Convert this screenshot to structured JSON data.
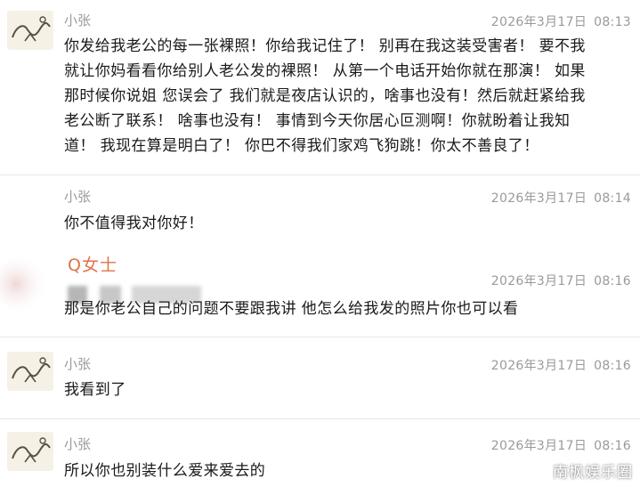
{
  "messages": [
    {
      "sender": "小张",
      "date": "2026年3月17日",
      "time": "08:13",
      "lines": [
        "你发给我老公的每一张裸照！你给我记住了！ 别再在我这装受害者！ 要不我",
        "就让你妈看看你给别人老公发的裸照！ 从第一个电话开始你就在那演！ 如果",
        "那时候你说姐 您误会了 我们就是夜店认识的，啥事也没有！然后就赶紧给我",
        "老公断了联系！ 啥事也没有！ 事情到今天你居心叵测啊！你就盼着让我知",
        "道！ 我现在算是明白了！ 你巴不得我们家鸡飞狗跳！你太不善良了！"
      ]
    },
    {
      "sender": "小张",
      "date": "2026年3月17日",
      "time": "08:14",
      "text": "你不值得我对你好！"
    },
    {
      "sender": "Q女士",
      "date": "2026年3月17日",
      "time": "08:16",
      "text": "那是你老公自己的问题不要跟我讲 他怎么给我发的照片你也可以看"
    },
    {
      "sender": "小张",
      "date": "2026年3月17日",
      "time": "08:16",
      "text": "我看到了"
    },
    {
      "sender": "小张",
      "date": "2026年3月17日",
      "time": "08:16",
      "text": "所以你也别装什么爱来爱去的"
    }
  ],
  "watermark": "南枫娱乐圈",
  "colors": {
    "name_gray": "#9a9a9a",
    "q_name": "#e0734a",
    "text": "#1a1a1a",
    "divider": "#e6e6e6"
  }
}
